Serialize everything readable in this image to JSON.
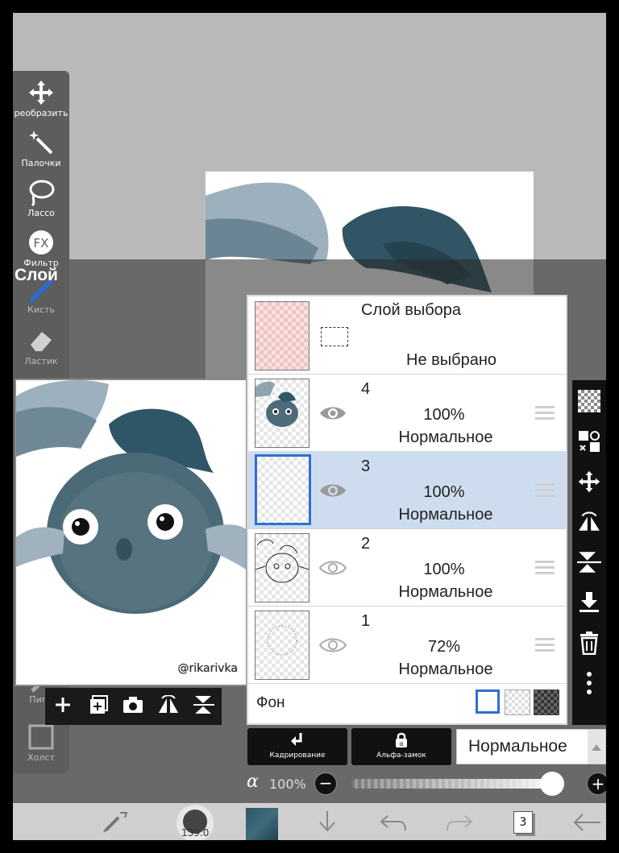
{
  "left_toolbar": {
    "tools": [
      {
        "label": "реобразить",
        "icon": "move-arrows-icon"
      },
      {
        "label": "Палочки",
        "icon": "magic-wand-icon"
      },
      {
        "label": "Лассо",
        "icon": "lasso-icon"
      },
      {
        "label": "Фильтр",
        "icon": "fx-icon"
      },
      {
        "label": "Кисть",
        "icon": "brush-icon"
      },
      {
        "label": "Ластик",
        "icon": "eraser-icon"
      },
      {
        "label": "Пипе",
        "icon": "eyedropper-icon"
      },
      {
        "label": "Холст",
        "icon": "canvas-icon"
      }
    ],
    "fx_text": "FX"
  },
  "layer_panel_title": "Слой",
  "preview": {
    "watermark": "@rikarivka"
  },
  "layers": {
    "selection_layer": {
      "name": "Слой выбора",
      "status": "Не выбрано"
    },
    "items": [
      {
        "number": "4",
        "opacity": "100%",
        "blend": "Нормальное"
      },
      {
        "number": "3",
        "opacity": "100%",
        "blend": "Нормальное"
      },
      {
        "number": "2",
        "opacity": "100%",
        "blend": "Нормальное"
      },
      {
        "number": "1",
        "opacity": "72%",
        "blend": "Нормальное"
      }
    ],
    "background_label": "Фон",
    "selected_layer": "3"
  },
  "bottom": {
    "crop_label": "Кадрирование",
    "alpha_lock_label": "Альфа-замок",
    "blend_mode": "Нормальное",
    "alpha_symbol": "α",
    "alpha_value": "100%",
    "alpha_fraction": 1.0,
    "brush_size_label": "139.0",
    "layer_count": "3"
  },
  "colors": {
    "selected_row": "#cdddef",
    "selection_border": "#2f6fd1",
    "current_color": "#2e5566"
  }
}
